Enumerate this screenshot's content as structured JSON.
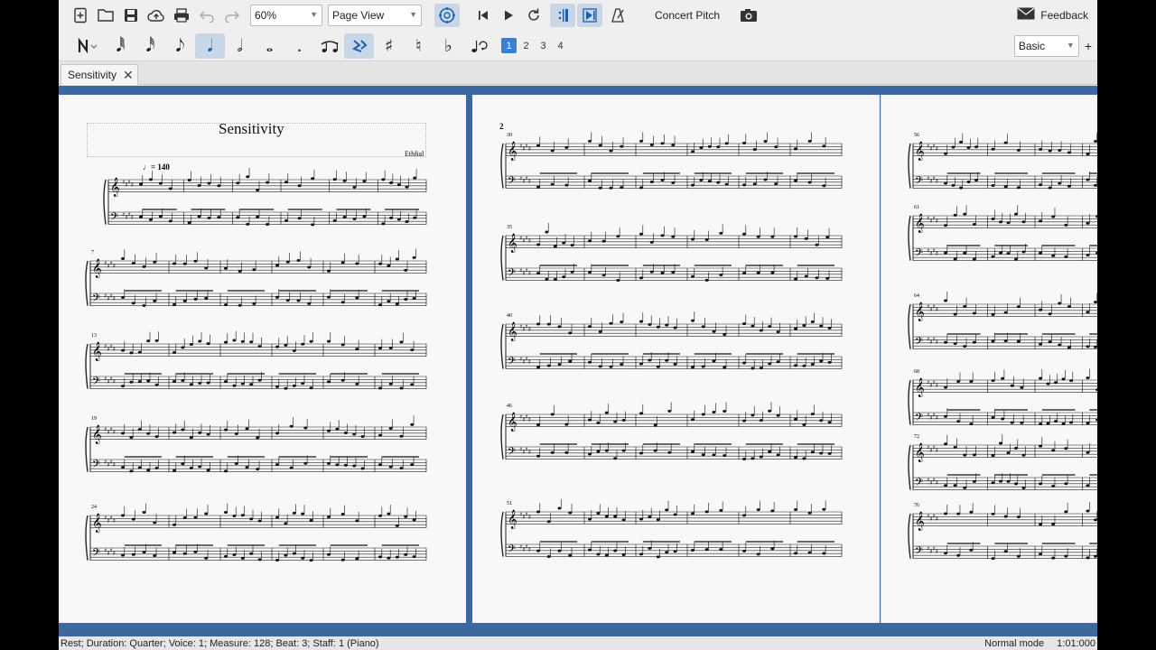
{
  "toolbar": {
    "zoom_value": "60%",
    "view_mode": "Page View",
    "concert_pitch_label": "Concert Pitch",
    "feedback_label": "Feedback",
    "workspace_value": "Basic"
  },
  "palette": {
    "voices": [
      "1",
      "2",
      "3",
      "4"
    ]
  },
  "tabs": [
    {
      "label": "Sensitivity"
    }
  ],
  "score": {
    "title": "Sensitivity",
    "composer": "Ethlial",
    "tempo": "♩= 140",
    "page2_number": "2",
    "page1_measures": [
      "7",
      "13",
      "19",
      "24"
    ],
    "page2_measures": [
      "30",
      "35",
      "40",
      "46",
      "51"
    ],
    "page3_measures": [
      "56",
      "61",
      "64",
      "68",
      "72",
      "76"
    ]
  },
  "status": {
    "left": "Rest; Duration: Quarter; Voice: 1;  Measure: 128; Beat: 3; Staff: 1 (Piano)",
    "mode": "Normal mode",
    "time": "1:01:000"
  },
  "colors": {
    "canvas": "#3b68a0",
    "accent": "#1a5fb4"
  }
}
